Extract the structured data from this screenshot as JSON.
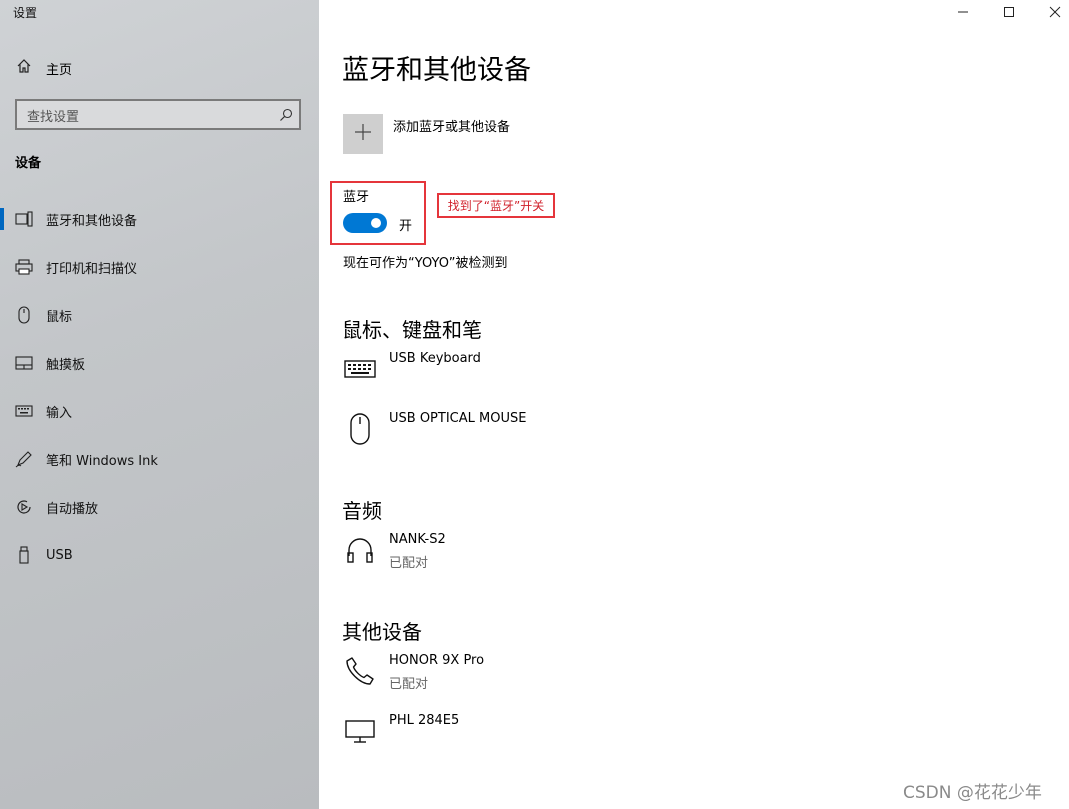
{
  "window": {
    "title": "设置",
    "controls": [
      {
        "name": "minimize",
        "icon": "minimize-icon"
      },
      {
        "name": "maximize",
        "icon": "maximize-icon"
      },
      {
        "name": "close",
        "icon": "close-icon"
      }
    ]
  },
  "sidebar": {
    "home": {
      "label": "主页",
      "icon": "home-icon"
    },
    "search": {
      "placeholder": "查找设置",
      "icon": "search-icon"
    },
    "section_heading": "设备",
    "items": [
      {
        "label": "蓝牙和其他设备",
        "icon": "bluetooth-devices-icon",
        "selected": true
      },
      {
        "label": "打印机和扫描仪",
        "icon": "printer-icon",
        "selected": false
      },
      {
        "label": "鼠标",
        "icon": "mouse-icon",
        "selected": false
      },
      {
        "label": "触摸板",
        "icon": "touchpad-icon",
        "selected": false
      },
      {
        "label": "输入",
        "icon": "keyboard-icon",
        "selected": false
      },
      {
        "label": "笔和 Windows Ink",
        "icon": "pen-icon",
        "selected": false
      },
      {
        "label": "自动播放",
        "icon": "autoplay-icon",
        "selected": false
      },
      {
        "label": "USB",
        "icon": "usb-icon",
        "selected": false
      }
    ]
  },
  "main": {
    "title": "蓝牙和其他设备",
    "add_device": {
      "label": "添加蓝牙或其他设备",
      "icon": "plus-icon"
    },
    "bluetooth": {
      "label": "蓝牙",
      "state": "开",
      "on": true
    },
    "annotation": "找到了“蓝牙”开关",
    "discoverable_text": "现在可作为“YOYO”被检测到",
    "groups": [
      {
        "title": "鼠标、键盘和笔",
        "devices": [
          {
            "name": "USB Keyboard",
            "status": "",
            "icon": "keyboard-icon"
          },
          {
            "name": "USB OPTICAL MOUSE",
            "status": "",
            "icon": "mouse-icon"
          }
        ]
      },
      {
        "title": "音频",
        "devices": [
          {
            "name": "NANK-S2",
            "status": "已配对",
            "icon": "headphones-icon"
          }
        ]
      },
      {
        "title": "其他设备",
        "devices": [
          {
            "name": "HONOR 9X Pro",
            "status": "已配对",
            "icon": "phone-icon"
          },
          {
            "name": "PHL 284E5",
            "status": "",
            "icon": "monitor-icon"
          }
        ]
      }
    ]
  },
  "colors": {
    "accent": "#0078d4",
    "annotation": "#e5353b"
  },
  "watermark": "CSDN @花花少年"
}
